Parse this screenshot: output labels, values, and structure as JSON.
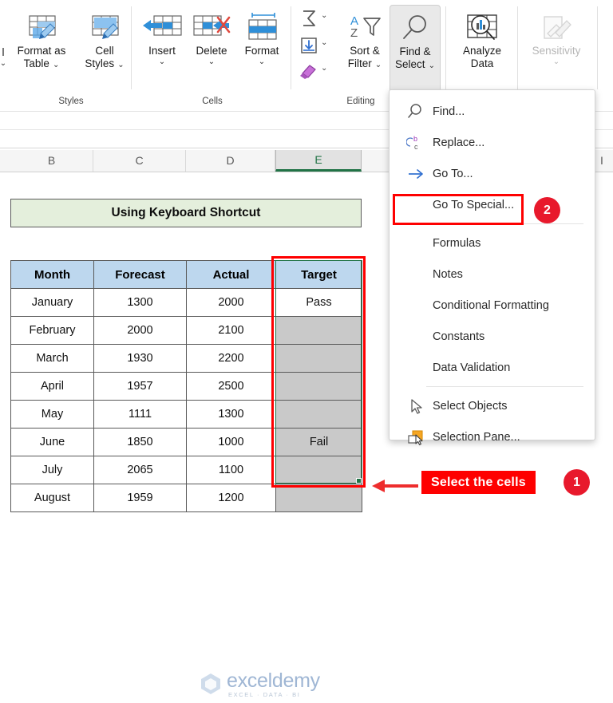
{
  "ribbon": {
    "groups": [
      {
        "name": "Styles",
        "label": "Styles"
      },
      {
        "name": "Cells",
        "label": "Cells"
      },
      {
        "name": "Editing",
        "label": "Editing"
      }
    ],
    "styles": {
      "format_as_table": {
        "line1": "Format as",
        "line2": "Table",
        "chevron": "⌄",
        "icon": "format-as-table-icon"
      },
      "cell_styles": {
        "line1": "Cell",
        "line2": "Styles",
        "chevron": "⌄",
        "icon": "cell-styles-icon"
      }
    },
    "cells": {
      "insert": {
        "label": "Insert",
        "chevron": "⌄",
        "icon": "insert-cells-icon"
      },
      "delete": {
        "label": "Delete",
        "chevron": "⌄",
        "icon": "delete-cells-icon"
      },
      "format": {
        "label": "Format",
        "chevron": "⌄",
        "icon": "format-cells-icon"
      }
    },
    "editing": {
      "autosum": {
        "icon": "autosum-icon",
        "chevron": "⌄"
      },
      "fill": {
        "icon": "fill-down-icon",
        "chevron": "⌄"
      },
      "clear": {
        "icon": "clear-eraser-icon",
        "chevron": "⌄"
      },
      "sort_filter": {
        "line1": "Sort &",
        "line2": "Filter",
        "chevron": "⌄",
        "icon": "sort-and-filter-icon"
      },
      "find_select": {
        "line1": "Find &",
        "line2": "Select",
        "chevron": "⌄",
        "icon": "find-and-select-icon"
      }
    },
    "analysis": {
      "analyze_data": {
        "line1": "Analyze",
        "line2": "Data",
        "icon": "analyze-data-icon"
      },
      "sensitivity": {
        "label": "Sensitivity",
        "chevron": "⌄",
        "icon": "sensitivity-icon"
      }
    }
  },
  "columns": [
    {
      "letter": "B",
      "active": false
    },
    {
      "letter": "C",
      "active": false
    },
    {
      "letter": "D",
      "active": false
    },
    {
      "letter": "E",
      "active": true
    },
    {
      "letter": "I",
      "active": false
    }
  ],
  "sheet": {
    "banner_title": "Using Keyboard Shortcut",
    "table": {
      "headers": [
        "Month",
        "Forecast",
        "Actual",
        "Target"
      ],
      "rows": [
        {
          "month": "January",
          "forecast": "1300",
          "actual": "2000",
          "target": "Pass"
        },
        {
          "month": "February",
          "forecast": "2000",
          "actual": "2100",
          "target": ""
        },
        {
          "month": "March",
          "forecast": "1930",
          "actual": "2200",
          "target": ""
        },
        {
          "month": "April",
          "forecast": "1957",
          "actual": "2500",
          "target": ""
        },
        {
          "month": "May",
          "forecast": "1111",
          "actual": "1300",
          "target": ""
        },
        {
          "month": "June",
          "forecast": "1850",
          "actual": "1000",
          "target": "Fail"
        },
        {
          "month": "July",
          "forecast": "2065",
          "actual": "1100",
          "target": ""
        },
        {
          "month": "August",
          "forecast": "1959",
          "actual": "1200",
          "target": ""
        }
      ]
    }
  },
  "watermark": {
    "name": "exceldemy",
    "tagline": "EXCEL · DATA · BI"
  },
  "menu": {
    "items": [
      {
        "label": "Find...",
        "underline": "F",
        "icon": "search-icon",
        "separator_after": false
      },
      {
        "label": "Replace...",
        "underline": "R",
        "icon": "replace-icon",
        "separator_after": false
      },
      {
        "label": "Go To...",
        "underline": "G",
        "icon": "goto-arrow-icon",
        "separator_after": false,
        "highlighted": true
      },
      {
        "label": "Go To Special...",
        "underline": "S",
        "icon": "none",
        "separator_after": true
      },
      {
        "label": "Formulas",
        "underline": "u",
        "icon": "none",
        "separator_after": false
      },
      {
        "label": "Notes",
        "underline": "N",
        "icon": "none",
        "separator_after": false
      },
      {
        "label": "Conditional Formatting",
        "underline": "C",
        "icon": "none",
        "separator_after": false
      },
      {
        "label": "Constants",
        "underline": "n",
        "icon": "none",
        "separator_after": false
      },
      {
        "label": "Data Validation",
        "underline": "V",
        "icon": "none",
        "separator_after": true
      },
      {
        "label": "Select Objects",
        "underline": "O",
        "icon": "select-objects-icon",
        "separator_after": false
      },
      {
        "label": "Selection Pane...",
        "underline": "P",
        "icon": "selection-pane-icon",
        "separator_after": false
      }
    ]
  },
  "annotations": {
    "step1": {
      "text": "Select the cells",
      "badge": "1"
    },
    "step2": {
      "badge": "2"
    }
  },
  "colors": {
    "excel_green": "#217346",
    "callout_red": "#fe0000",
    "badge_red": "#e8192c",
    "banner_green": "#e4efdc",
    "table_header_blue": "#bdd7ee",
    "selected_cell_gray": "#c9c9c9"
  }
}
